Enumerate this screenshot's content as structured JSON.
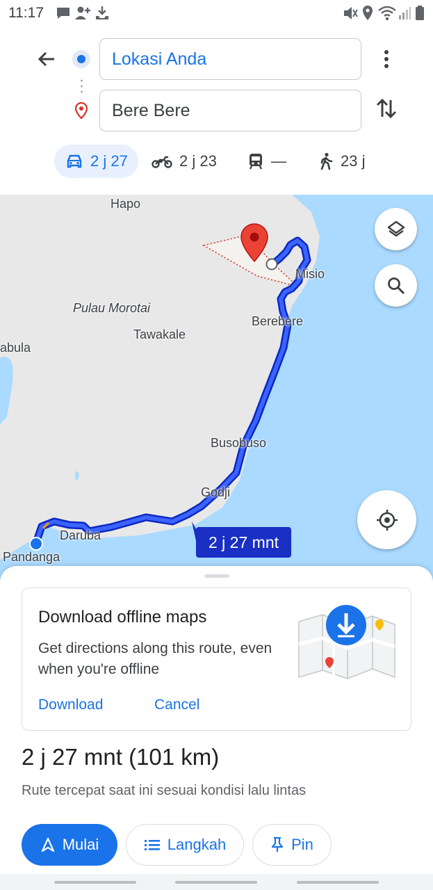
{
  "status_bar": {
    "time": "11:17",
    "left_icons": [
      "chat-bubble-icon",
      "person-add-icon",
      "download-icon"
    ],
    "right_icons": [
      "mute-icon",
      "location-icon",
      "wifi-icon",
      "signal-icon",
      "battery-icon"
    ]
  },
  "directions": {
    "origin": "Lokasi Anda",
    "destination": "Bere Bere",
    "icons": [
      "back-arrow-icon",
      "more-vert-icon",
      "swap-icon"
    ]
  },
  "modes": [
    {
      "icon": "car-icon",
      "label": "2 j 27",
      "active": true
    },
    {
      "icon": "motorcycle-icon",
      "label": "2 j 23",
      "active": false
    },
    {
      "icon": "transit-icon",
      "label": "—",
      "active": false
    },
    {
      "icon": "walk-icon",
      "label": "23 j",
      "active": false
    }
  ],
  "map": {
    "labels": {
      "hapo": "Hapo",
      "island": "Pulau Morotai",
      "tawakale": "Tawakale",
      "abula": "abula",
      "misio": "Misio",
      "berebere": "Berebere",
      "busobuso": "Busobuso",
      "godji": "Godji",
      "daruba": "Daruba",
      "pandanga": "Pandanga"
    },
    "time_chip": "2 j 27 mnt",
    "colors": {
      "water": "#aadaff",
      "land": "#e8e8e8",
      "route": "#1a3cf0",
      "pin": "#ea4335"
    }
  },
  "offline_card": {
    "title": "Download offline maps",
    "description": "Get directions along this route, even when you're offline",
    "download": "Download",
    "cancel": "Cancel"
  },
  "route": {
    "time": "2 j 27 mnt (101 km)",
    "subtitle": "Rute tercepat saat ini sesuai kondisi lalu lintas"
  },
  "actions": {
    "start": "Mulai",
    "steps": "Langkah",
    "pin": "Pin"
  },
  "colors": {
    "accent": "#1a73e8",
    "chip_bg": "#e8f0fe"
  }
}
